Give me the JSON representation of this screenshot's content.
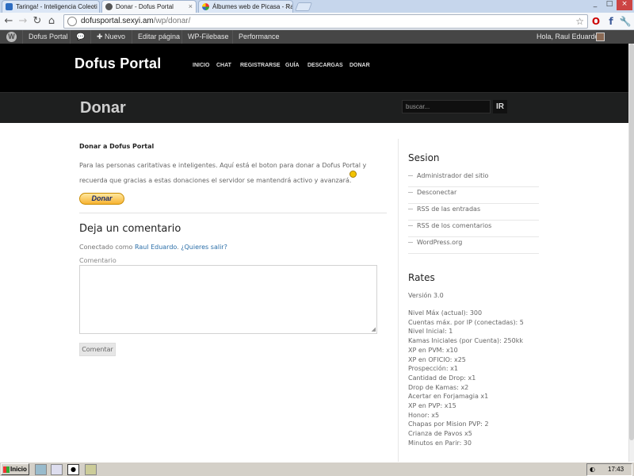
{
  "browser": {
    "tabs": [
      {
        "label": "Taringa! - Inteligencia Colecti"
      },
      {
        "label": "Donar - Dofus Portal"
      },
      {
        "label": "Álbumes web de Picasa - Raul"
      }
    ],
    "url_host": "dofusportal.sexyi.am",
    "url_path": "/wp/donar/"
  },
  "adminbar": {
    "site": "Dofus Portal",
    "new": "Nuevo",
    "edit": "Editar página",
    "filebase": "WP-Filebase",
    "performance": "Performance",
    "greeting": "Hola, Raul Eduardo"
  },
  "header": {
    "site_title": "Dofus Portal",
    "nav": [
      "INICIO",
      "CHAT",
      "REGISTRARSE",
      "GUÍA",
      "DESCARGAS",
      "DONAR"
    ]
  },
  "titlebar": {
    "page_title": "Donar",
    "search_placeholder": "buscar...",
    "search_button": "IR"
  },
  "post": {
    "title": "Donar a Dofus Portal",
    "line1": "Para las personas caritativas e inteligentes. Aquí está el boton para donar a Dofus Portal  y",
    "line2": "recuerda que gracias a estas donaciones el servidor se mantendrá activo y avanzará.",
    "donate_button": "Donar"
  },
  "comments": {
    "heading": "Deja un comentario",
    "logged_prefix": "Conectado como ",
    "logged_user": "Raul Eduardo",
    "logout": "¿Quieres salir?",
    "comment_label": "Comentario",
    "submit": "Comentar"
  },
  "sidebar": {
    "session_title": "Sesion",
    "session_links": [
      "Administrador del sitio",
      "Desconectar",
      "RSS de las entradas",
      "RSS de los comentarios",
      "WordPress.org"
    ],
    "rates_title": "Rates",
    "version": "Versión 3.0",
    "rates": [
      "Nivel Máx (actual): 300",
      "Cuentas máx. por IP (conectadas): 5",
      "Nivel Inicial: 1",
      "Kamas Iniciales (por Cuenta): 250kk",
      "XP en PVM: x10",
      "XP en OFICIO: x25",
      "Prospección: x1",
      "Cantidad de Drop: x1",
      "Drop de Kamas: x2",
      "Acertar en Forjamagia x1",
      "XP en PVP: x15",
      "Honor: x5",
      "Chapas por Mision PVP: 2",
      "Crianza de Pavos x5",
      "Minutos en Parir: 30"
    ]
  },
  "taskbar": {
    "start": "Inicio",
    "clock": "17:43"
  },
  "colors": {
    "header_bg": "#000000",
    "titlebar_bg": "#1e1f1f",
    "link": "#2a6ea8",
    "donate_button": "#f7b332"
  }
}
